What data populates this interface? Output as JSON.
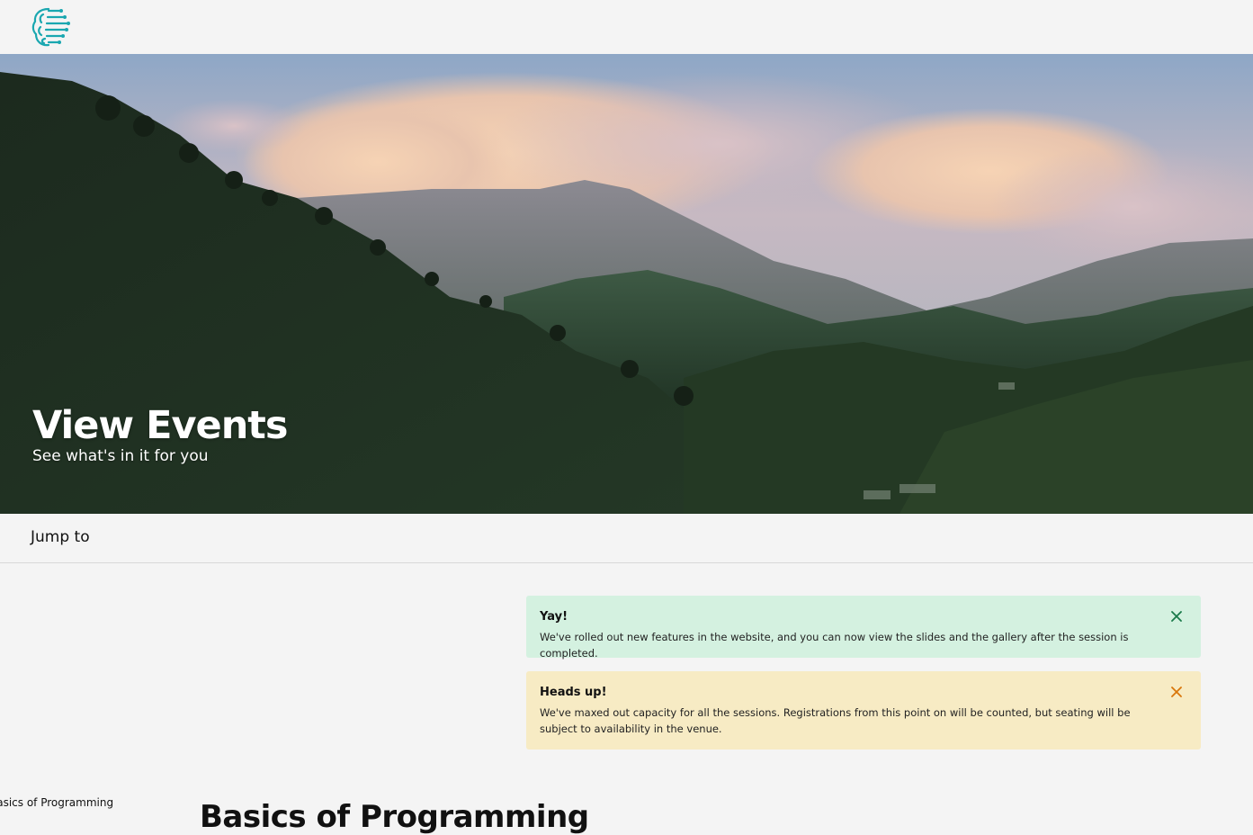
{
  "header": {
    "logo_icon": "brain-circuit-icon",
    "logo_color": "#1aa7b0"
  },
  "hero": {
    "title": "View Events",
    "subtitle": "See what's in it for you"
  },
  "jumpbar": {
    "label": "Jump to"
  },
  "alerts": [
    {
      "type": "success",
      "title": "Yay!",
      "body": "We've rolled out new features in the website, and you can now view the slides and the gallery after the session is completed.",
      "close_icon": "close-icon",
      "color": "#d4f1e0",
      "close_color": "#1a7a4a"
    },
    {
      "type": "warning",
      "title": "Heads up!",
      "body": "We've maxed out capacity for all the sessions. Registrations from this point on will be counted, but seating will be subject to availability in the venue.",
      "close_icon": "close-icon",
      "color": "#f7ebc4",
      "close_color": "#d9760a"
    }
  ],
  "sidebar": {
    "items": [
      {
        "label": "Basics of Programming"
      }
    ]
  },
  "main": {
    "section_title": "Basics of Programming"
  }
}
